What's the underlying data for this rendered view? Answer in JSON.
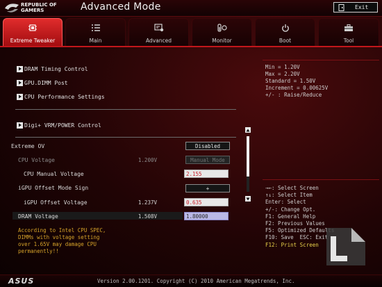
{
  "header": {
    "brand_line1": "REPUBLIC OF",
    "brand_line2": "GAMERS",
    "title": "Advanced Mode",
    "exit_label": "Exit"
  },
  "tabs": [
    {
      "label": "Extreme Tweaker",
      "icon": "cpu-chip-icon",
      "active": true
    },
    {
      "label": "Main",
      "icon": "list-icon",
      "active": false
    },
    {
      "label": "Advanced",
      "icon": "advanced-settings-icon",
      "active": false
    },
    {
      "label": "Monitor",
      "icon": "monitor-gauge-icon",
      "active": false
    },
    {
      "label": "Boot",
      "icon": "power-icon",
      "active": false
    },
    {
      "label": "Tool",
      "icon": "toolbox-icon",
      "active": false
    }
  ],
  "main": {
    "menu_links": [
      "DRAM Timing Control",
      "GPU.DIMM Post",
      "CPU Performance Settings"
    ],
    "digi_link": "Digi+ VRM/POWER Control",
    "rows": {
      "extreme_ov": {
        "label": "Extreme OV",
        "field": "Disabled"
      },
      "cpu_voltage": {
        "label": "CPU Voltage",
        "current": "1.200V",
        "field": "Manual Mode"
      },
      "cpu_manual_voltage": {
        "label": "CPU Manual Voltage",
        "field": "2.155"
      },
      "igpu_offset_mode": {
        "label": "iGPU Offset Mode Sign",
        "field": "+"
      },
      "igpu_offset_voltage": {
        "label": "iGPU Offset Voltage",
        "current": "1.237V",
        "field": "0.635"
      },
      "dram_voltage": {
        "label": "DRAM Voltage",
        "current": "1.508V",
        "field": "1.80000"
      }
    },
    "help_lines": [
      "According to Intel CPU SPEC,",
      "DIMMs with voltage setting",
      "over 1.65V may damage CPU",
      "permanently!!"
    ]
  },
  "info": {
    "lines": [
      "Min = 1.20V",
      "Max = 2.20V",
      "Standard = 1.50V",
      "Increment = 0.00625V",
      "+/- : Raise/Reduce"
    ]
  },
  "keys": [
    "→←: Select Screen",
    "↑↓: Select Item",
    "Enter: Select",
    "+/-: Change Opt.",
    "F1: General Help",
    "F2: Previous Values",
    "F5: Optimized Defaults",
    "F10: Save  ESC: Exit",
    "F12: Print Screen"
  ],
  "footer": {
    "brand": "ASUS",
    "version": "Version 2.00.1201. Copyright (C) 2010 American Megatrends, Inc."
  },
  "colors": {
    "accent_red": "#c2161b",
    "warning_text": "#d6a32a",
    "selected_field": "#b9b8e6"
  }
}
